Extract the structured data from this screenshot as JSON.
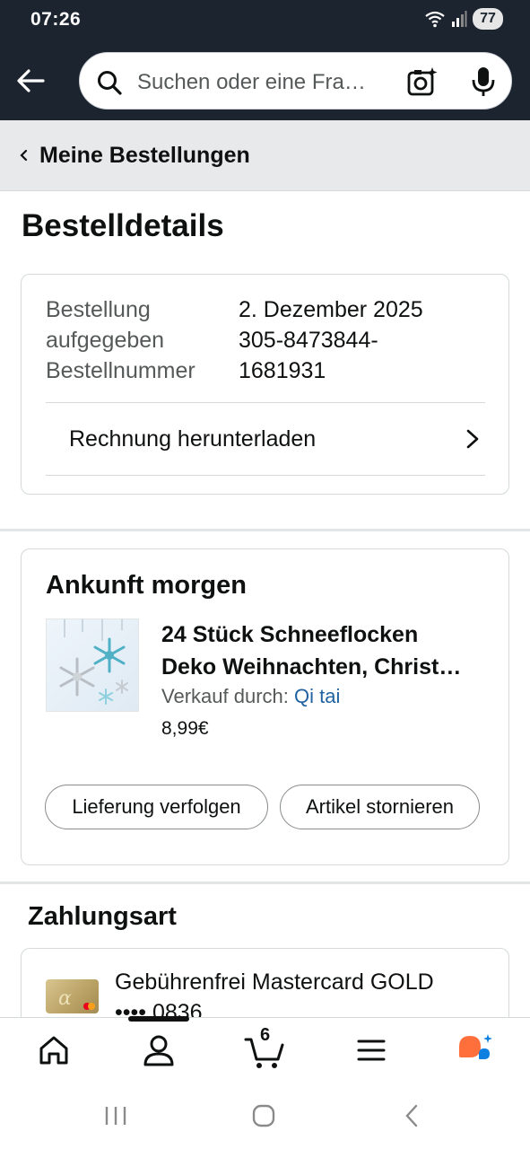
{
  "status_bar": {
    "time": "07:26",
    "battery": "77"
  },
  "search": {
    "placeholder": "Suchen oder eine Fra…"
  },
  "breadcrumb": {
    "label": "Meine Bestellungen"
  },
  "page": {
    "title": "Bestelldetails"
  },
  "order": {
    "label_placed_1": "Bestellung",
    "label_placed_2": "aufgegeben",
    "label_number": "Bestellnummer",
    "date": "2. Dezember 2025",
    "number_1": "305-8473844-",
    "number_2": "1681931",
    "invoice_link": "Rechnung herunterladen"
  },
  "arrival": {
    "title": "Ankunft morgen",
    "product_line_1": "24 Stück Schneeflocken",
    "product_line_2": "Deko Weihnachten, Christ…",
    "seller_prefix": "Verkauf durch:",
    "seller_name": "Qi tai",
    "price": "8,99€",
    "track_button": "Lieferung verfolgen",
    "cancel_button": "Artikel stornieren"
  },
  "payment": {
    "title": "Zahlungsart",
    "card_name": "Gebührenfrei Mastercard GOLD",
    "card_last_digits": "•••• 0836"
  },
  "bottom_nav": {
    "cart_count": "6"
  },
  "colors": {
    "header_bg": "#1c2430",
    "link": "#2162a1",
    "assistant_orange": "#ff6f3c",
    "assistant_blue": "#0d7fe0"
  }
}
